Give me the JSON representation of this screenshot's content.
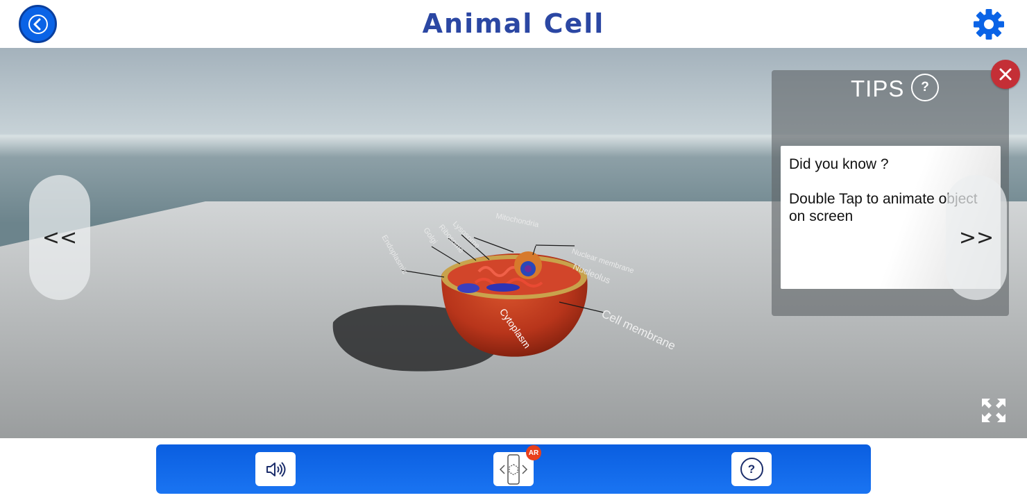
{
  "header": {
    "title": "Animal Cell",
    "back_icon": "chevron-left-icon",
    "settings_icon": "gear-icon"
  },
  "viewport": {
    "prev_label": "<<",
    "next_label": ">>",
    "fullscreen_icon": "expand-icon",
    "cell_labels": {
      "cytoplasm": "Cytoplasm",
      "cell_membrane": "Cell membrane",
      "nucleolus": "Nucleolus",
      "nuclear_membrane": "Nuclear membrane"
    }
  },
  "tips": {
    "title": "TIPS",
    "help_label": "?",
    "line1": "Did you know ?",
    "line2": "Double Tap to animate object on screen",
    "close_icon": "close-icon"
  },
  "toolbar": {
    "sound_icon": "speaker-icon",
    "ar_icon": "ar-phone-icon",
    "ar_badge": "AR",
    "help_label": "?"
  },
  "colors": {
    "title": "#2b47a3",
    "primary": "#0a63e6",
    "toolbar": "#1a74f2",
    "close": "#c42f36",
    "ar_badge": "#e8401c",
    "cell": "#b8351b"
  }
}
